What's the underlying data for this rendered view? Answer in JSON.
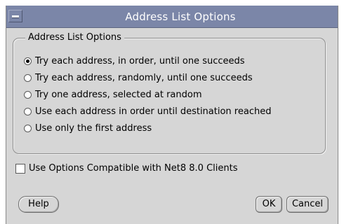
{
  "window": {
    "title": "Address List Options"
  },
  "group": {
    "legend": "Address List Options",
    "options": [
      {
        "label": "Try each address, in order, until one succeeds",
        "selected": true
      },
      {
        "label": "Try each address, randomly, until one succeeds",
        "selected": false
      },
      {
        "label": "Try one address, selected at random",
        "selected": false
      },
      {
        "label": "Use each address in order until destination reached",
        "selected": false
      },
      {
        "label": "Use only the first address",
        "selected": false
      }
    ]
  },
  "compat_checkbox": {
    "label": "Use Options Compatible with Net8 8.0 Clients",
    "checked": false
  },
  "buttons": {
    "help": "Help",
    "ok": "OK",
    "cancel": "Cancel"
  },
  "colors": {
    "titlebar": "#7b86a8",
    "window_bg": "#d6d6d6"
  }
}
